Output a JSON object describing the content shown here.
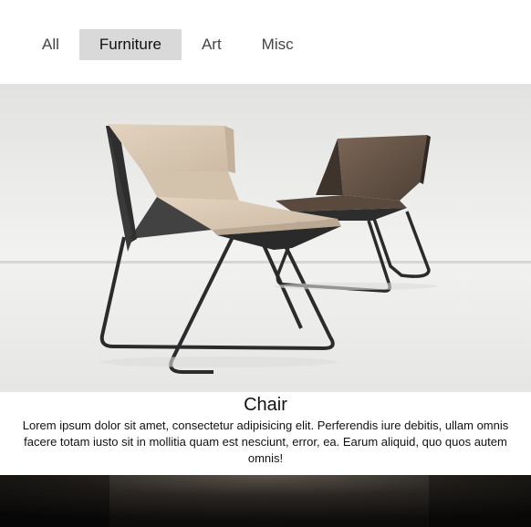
{
  "nav": {
    "filters": [
      {
        "label": "All",
        "active": false
      },
      {
        "label": "Furniture",
        "active": true
      },
      {
        "label": "Art",
        "active": false
      },
      {
        "label": "Misc",
        "active": false
      }
    ]
  },
  "gallery": {
    "items": [
      {
        "title": "Chair",
        "description": "Lorem ipsum dolor sit amet, consectetur adipisicing elit. Perferendis iure debitis, ullam omnis facere totam iusto sit in mollitia quam est nesciunt, error, ea. Earum aliquid, quo quos autem omnis!"
      }
    ]
  },
  "colors": {
    "active_filter_bg": "#d9d9d9",
    "chair_front_seat": "#dccbb6",
    "chair_back_seat": "#6b5a4c",
    "chair_frame": "#2b2b2b"
  }
}
